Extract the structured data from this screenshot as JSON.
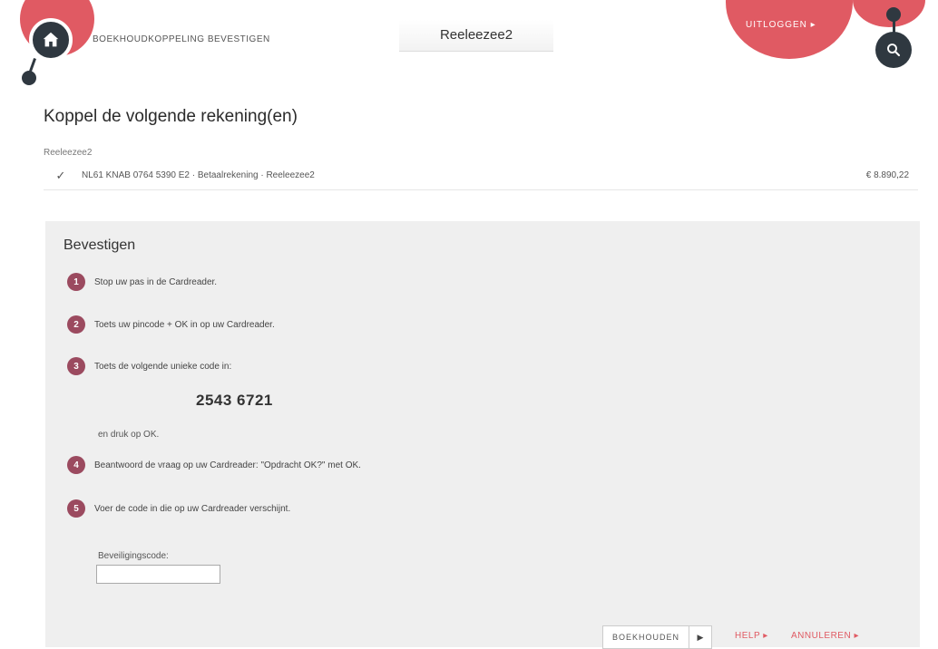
{
  "header": {
    "breadcrumb": "BOEKHOUDKOPPELING BEVESTIGEN",
    "app_title": "Reeleezee2",
    "logout_label": "UITLOGGEN ▸"
  },
  "main": {
    "title": "Koppel de volgende rekening(en)",
    "account_group": "Reeleezee2",
    "account": {
      "description": "NL61 KNAB 0764 5390 E2 · Betaalrekening · Reeleezee2",
      "amount": "€ 8.890,22"
    }
  },
  "confirm": {
    "title": "Bevestigen",
    "steps": [
      {
        "num": "1",
        "text": "Stop uw pas in de Cardreader."
      },
      {
        "num": "2",
        "text": "Toets uw pincode + OK in op uw Cardreader."
      },
      {
        "num": "3",
        "text": "Toets de volgende unieke code in:"
      },
      {
        "num": "4",
        "text": "Beantwoord de vraag op uw Cardreader: \"Opdracht OK?\" met OK."
      },
      {
        "num": "5",
        "text": "Voer de code in die op uw Cardreader verschijnt."
      }
    ],
    "code": "2543 6721",
    "code_after": "en druk op OK.",
    "security_label": "Beveiligingscode:",
    "security_value": ""
  },
  "actions": {
    "save": "BOEKHOUDEN",
    "help": "HELP ▸",
    "cancel": "ANNULEREN ▸"
  },
  "colors": {
    "accent": "#e05a63",
    "dark": "#2f3840",
    "step_badge": "#9b4a5f"
  }
}
